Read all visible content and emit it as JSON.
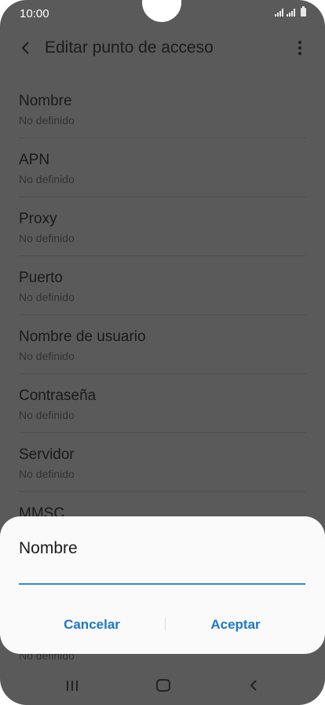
{
  "status_bar": {
    "time": "10:00",
    "icons": [
      "signal-icon",
      "signal-icon",
      "battery-icon"
    ]
  },
  "app_bar": {
    "title": "Editar punto de acceso",
    "back_icon": "back-arrow-icon",
    "menu_icon": "more-vert-icon"
  },
  "fields": [
    {
      "label": "Nombre",
      "value": "No definido"
    },
    {
      "label": "APN",
      "value": "No definido"
    },
    {
      "label": "Proxy",
      "value": "No definido"
    },
    {
      "label": "Puerto",
      "value": "No definido"
    },
    {
      "label": "Nombre de usuario",
      "value": "No definido"
    },
    {
      "label": "Contraseña",
      "value": "No definido"
    },
    {
      "label": "Servidor",
      "value": "No definido"
    },
    {
      "label": "MMSC",
      "value": "No definido"
    }
  ],
  "dialog": {
    "title": "Nombre",
    "input_value": "",
    "cancel_label": "Cancelar",
    "accept_label": "Aceptar",
    "accent_color": "#1f78c6"
  },
  "nav_bar": {
    "icons": [
      "recent-apps-icon",
      "home-icon",
      "back-icon"
    ]
  },
  "colors": {
    "scrim": "#5a5a5a",
    "dialog_bg": "#fafafa",
    "input_underline": "#2e8ccc"
  }
}
